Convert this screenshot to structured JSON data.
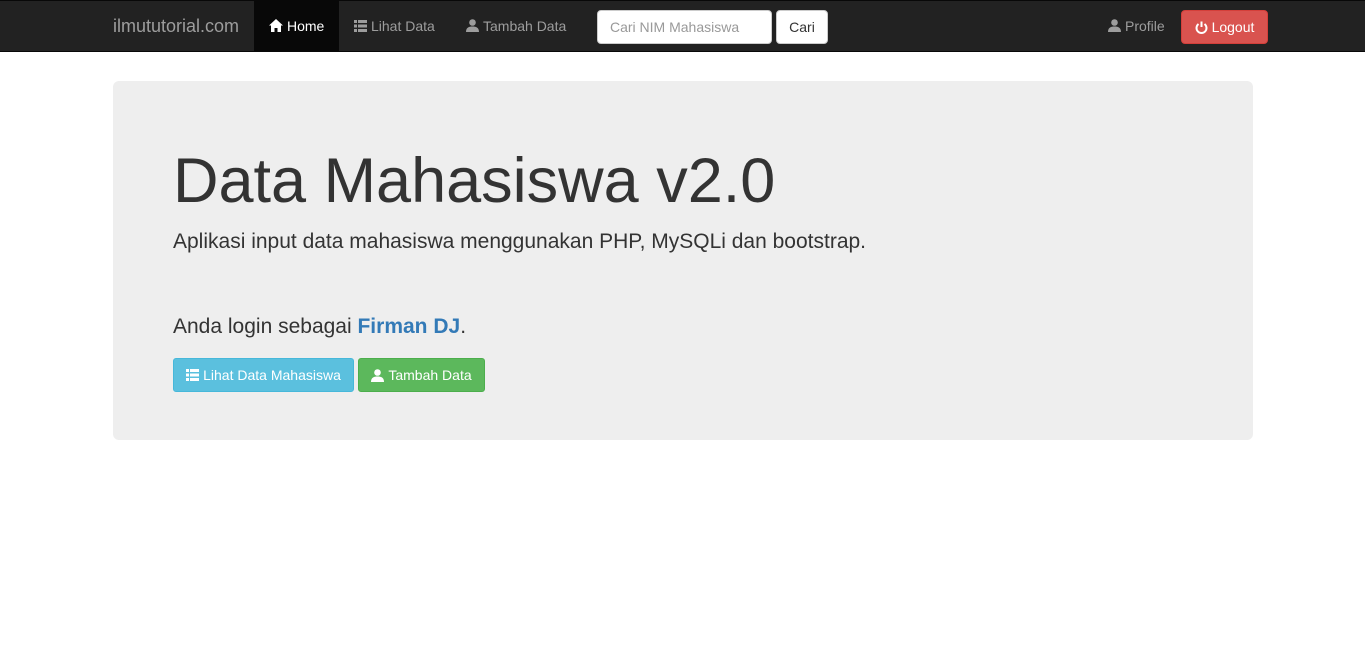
{
  "navbar": {
    "brand": "ilmututorial.com",
    "items": [
      {
        "label": "Home",
        "icon": "home-icon",
        "active": true
      },
      {
        "label": "Lihat Data",
        "icon": "list-icon",
        "active": false
      },
      {
        "label": "Tambah Data",
        "icon": "user-icon",
        "active": false
      }
    ],
    "search": {
      "placeholder": "Cari NIM Mahasiswa",
      "value": "",
      "button_label": "Cari"
    },
    "profile_label": "Profile",
    "logout_label": "Logout"
  },
  "jumbotron": {
    "title": "Data Mahasiswa v2.0",
    "subtitle": "Aplikasi input data mahasiswa menggunakan PHP, MySQLi dan bootstrap.",
    "login_prefix": "Anda login sebagai ",
    "username": "Firman DJ",
    "login_suffix": ".",
    "buttons": [
      {
        "label": "Lihat Data Mahasiswa",
        "icon": "list-icon"
      },
      {
        "label": "Tambah Data",
        "icon": "user-icon"
      }
    ]
  },
  "colors": {
    "navbar_bg": "#222222",
    "jumbotron_bg": "#eeeeee",
    "link": "#337ab7",
    "danger": "#d9534f",
    "info": "#5bc0de",
    "success": "#5cb85c"
  }
}
